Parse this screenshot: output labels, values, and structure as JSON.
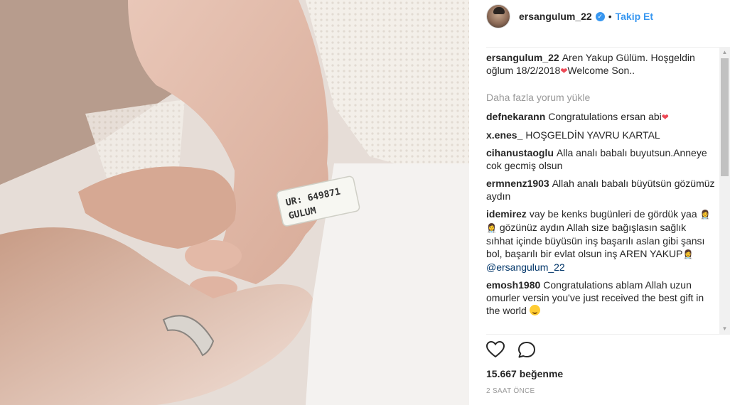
{
  "post": {
    "username": "ersangulum_22",
    "separator": "•",
    "follow_label": "Takip Et",
    "caption_author": "ersangulum_22",
    "caption_text_1": "Aren Yakup Gülüm. Hoşgeldin oğlum 18/2/2018",
    "caption_text_2": "Welcome Son..",
    "load_more": "Daha fazla yorum yükle",
    "likes": "15.667 beğenme",
    "time": "2 SAAT ÖNCE",
    "wristband": {
      "line1": "UR: 649871",
      "line2": "GULUM"
    }
  },
  "comments": [
    {
      "author": "defnekarann",
      "text": "Congratulations ersan abi"
    },
    {
      "author": "x.enes_",
      "text": "HOŞGELDİN YAVRU KARTAL"
    },
    {
      "author": "cihanustaoglu",
      "text": "Alla analı babalı buyutsun.Anneye cok gecmiş olsun"
    },
    {
      "author": "ermnenz1903",
      "text": "Allah analı babalı büyütsün gözümüz aydın"
    },
    {
      "author": "idemirez",
      "text_1": "vay be kenks bugünleri de gördük yaa",
      "text_2": "gözünüz aydın Allah size bağışlasın sağlık sıhhat içinde büyüsün inş başarılı aslan gibi şansı bol, başarılı bir evlat olsun inş AREN YAKUP",
      "mention": "@ersangulum_22"
    },
    {
      "author": "emosh1980",
      "text": "Congratulations ablam Allah uzun omurler versin you've just received the best gift in the world"
    }
  ],
  "icons": {
    "verified": "verified-badge-icon",
    "like": "heart-outline-icon",
    "comment": "speech-bubble-icon"
  },
  "colors": {
    "link_blue": "#3897f0",
    "muted": "#999999",
    "mention": "#003569",
    "heart_red": "#ed4956"
  }
}
